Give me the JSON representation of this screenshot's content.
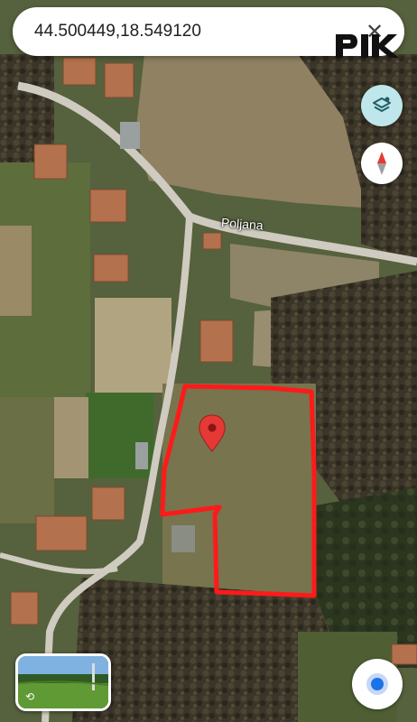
{
  "search": {
    "query": "44.500449,18.549120"
  },
  "map": {
    "type": "satellite",
    "road_label": "Poljana",
    "pin_color": "#e53935",
    "boundary_color": "#ff1a1a"
  },
  "controls": {
    "close_icon": "close-icon",
    "layers_icon": "layers-icon",
    "compass_icon": "compass-icon",
    "location_icon": "my-location-icon",
    "accent": "#1a73e8"
  },
  "watermark": {
    "text": "PIK"
  }
}
